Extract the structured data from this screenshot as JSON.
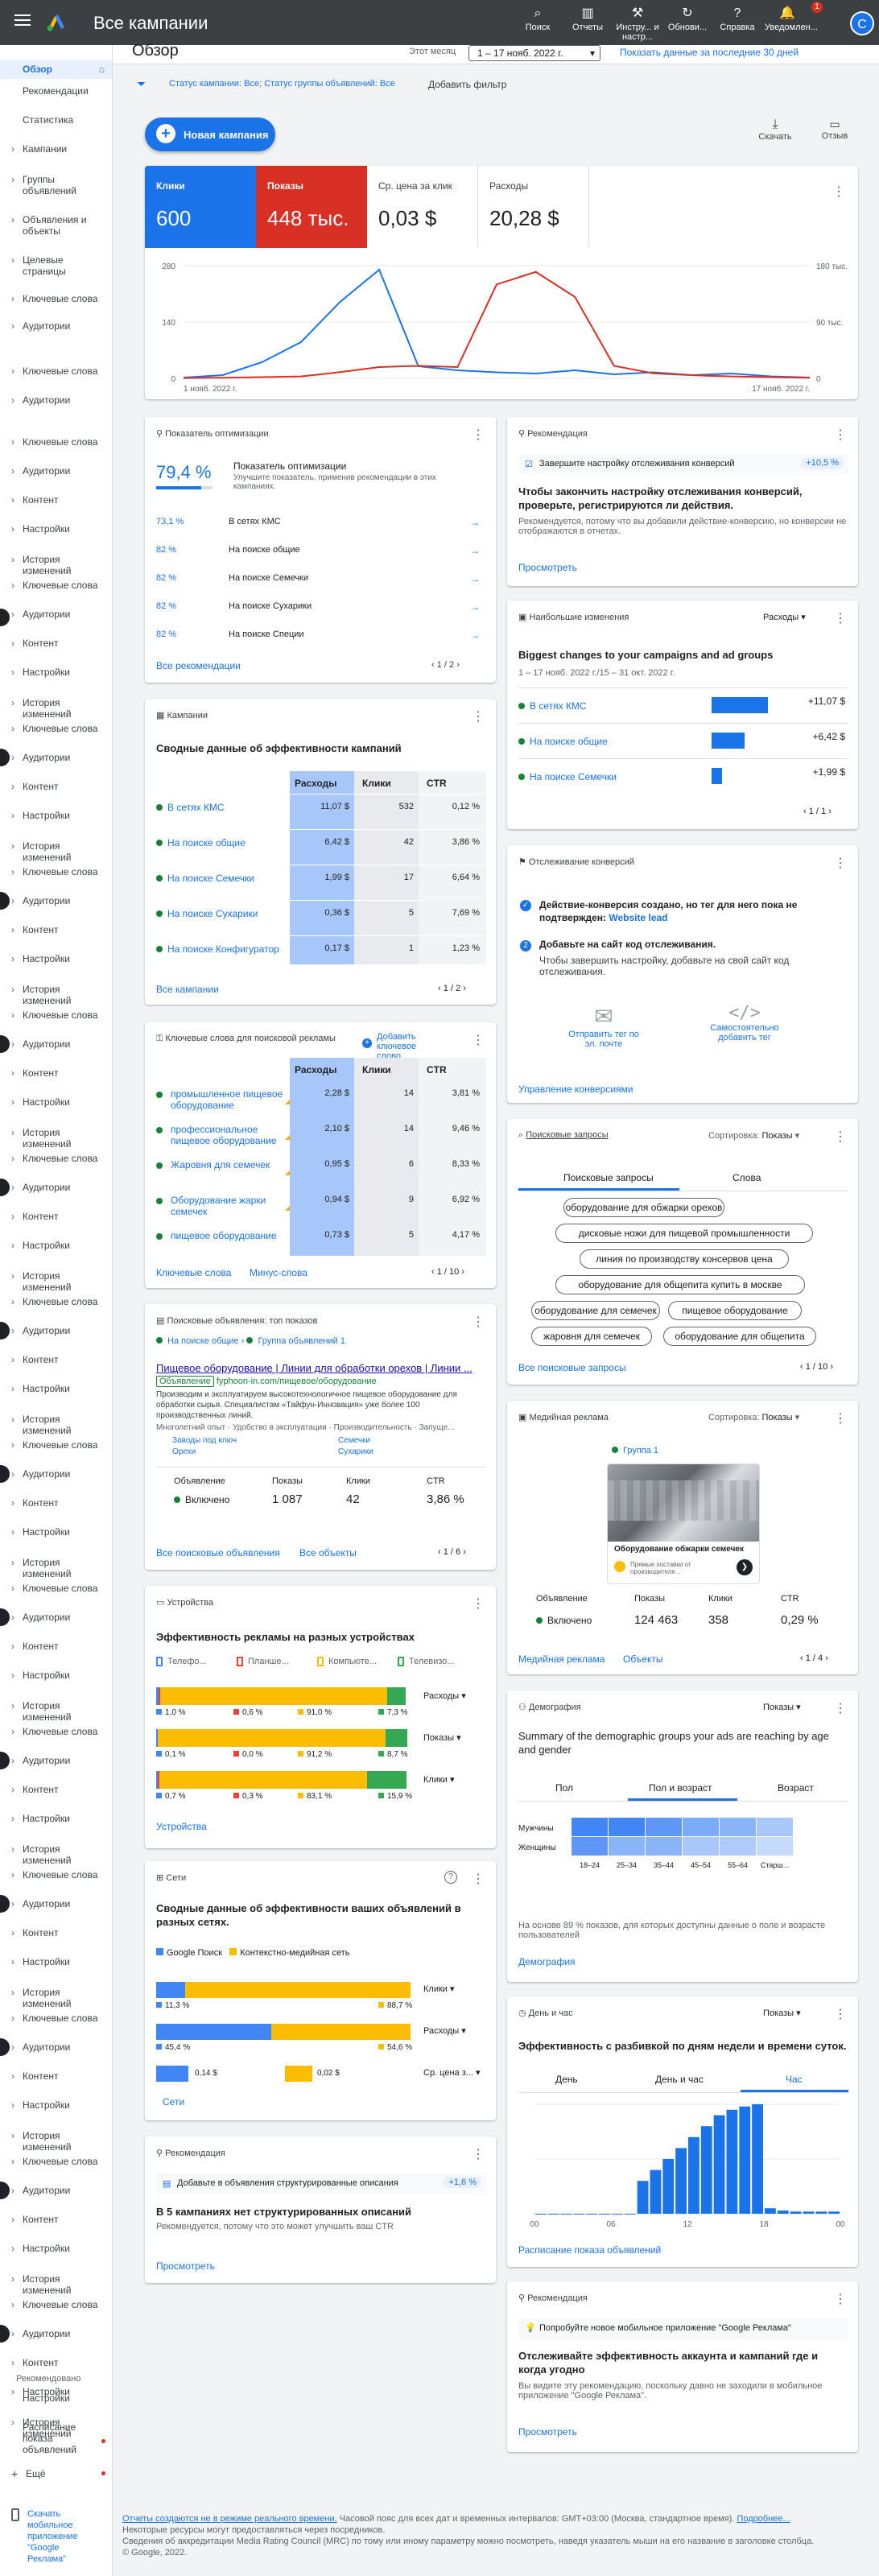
{
  "app": {
    "title": "Все кампании",
    "avatar_letter": "C",
    "notif_count": "1"
  },
  "toolbar": {
    "items": [
      "Поиск",
      "Отчеты",
      "Инстру... и настр...",
      "Обнови...",
      "Справка",
      "Уведомлен..."
    ]
  },
  "sidebar": {
    "items": [
      {
        "label": "Обзор",
        "y": 80,
        "sel": true,
        "arrow": false
      },
      {
        "label": "Рекомендации",
        "y": 112,
        "arrow": false
      },
      {
        "label": "Статистика",
        "y": 148,
        "arrow": false
      },
      {
        "label": "Кампании",
        "y": 184,
        "arrow": true
      },
      {
        "label": "Группы объявлений",
        "y": 222,
        "arrow": true
      },
      {
        "label": "Объявления и объекты",
        "y": 272,
        "arrow": true
      },
      {
        "label": "Целевые страницы",
        "y": 322,
        "arrow": true
      },
      {
        "label": "Ключевые слова",
        "y": 370,
        "arrow": true
      },
      {
        "label": "Аудитории",
        "y": 404,
        "arrow": true
      },
      {
        "label": "Ключевые слова",
        "y": 460,
        "arrow": true
      },
      {
        "label": "Аудитории",
        "y": 496,
        "arrow": true
      },
      {
        "label": "Ключевые слова",
        "y": 548,
        "arrow": true
      },
      {
        "label": "Аудитории",
        "y": 584,
        "arrow": true
      },
      {
        "label": "Контент",
        "y": 620,
        "arrow": true
      },
      {
        "label": "Настройки",
        "y": 656,
        "arrow": true
      },
      {
        "label": "История изменений",
        "y": 694,
        "arrow": true
      },
      {
        "label": "Ключевые слова",
        "y": 726,
        "arrow": true
      },
      {
        "label": "Аудитории",
        "y": 762,
        "arrow": true
      },
      {
        "label": "Контент",
        "y": 798,
        "arrow": true
      },
      {
        "label": "Настройки",
        "y": 834,
        "arrow": true
      },
      {
        "label": "История изменений",
        "y": 872,
        "arrow": true
      },
      {
        "label": "Ключевые слова",
        "y": 904,
        "arrow": true
      },
      {
        "label": "Аудитории",
        "y": 940,
        "arrow": true
      },
      {
        "label": "Контент",
        "y": 976,
        "arrow": true
      },
      {
        "label": "Настройки",
        "y": 1012,
        "arrow": true
      },
      {
        "label": "История изменений",
        "y": 1050,
        "arrow": true
      },
      {
        "label": "Ключевые слова",
        "y": 1082,
        "arrow": true
      },
      {
        "label": "Аудитории",
        "y": 1118,
        "arrow": true
      },
      {
        "label": "Контент",
        "y": 1154,
        "arrow": true
      },
      {
        "label": "Настройки",
        "y": 1190,
        "arrow": true
      },
      {
        "label": "История изменений",
        "y": 1228,
        "arrow": true
      },
      {
        "label": "Ключевые слова",
        "y": 1260,
        "arrow": true
      },
      {
        "label": "Аудитории",
        "y": 1296,
        "arrow": true
      },
      {
        "label": "Контент",
        "y": 1332,
        "arrow": true
      },
      {
        "label": "Настройки",
        "y": 1368,
        "arrow": true
      },
      {
        "label": "История изменений",
        "y": 1406,
        "arrow": true
      },
      {
        "label": "Ключевые слова",
        "y": 1438,
        "arrow": true
      },
      {
        "label": "Аудитории",
        "y": 1474,
        "arrow": true
      },
      {
        "label": "Контент",
        "y": 1510,
        "arrow": true
      },
      {
        "label": "Настройки",
        "y": 1546,
        "arrow": true
      },
      {
        "label": "История изменений",
        "y": 1584,
        "arrow": true
      },
      {
        "label": "Ключевые слова",
        "y": 1616,
        "arrow": true
      },
      {
        "label": "Аудитории",
        "y": 1652,
        "arrow": true
      },
      {
        "label": "Контент",
        "y": 1688,
        "arrow": true
      },
      {
        "label": "Настройки",
        "y": 1724,
        "arrow": true
      },
      {
        "label": "История изменений",
        "y": 1762,
        "arrow": true
      },
      {
        "label": "Ключевые слова",
        "y": 1794,
        "arrow": true
      },
      {
        "label": "Аудитории",
        "y": 1830,
        "arrow": true
      },
      {
        "label": "Контент",
        "y": 1866,
        "arrow": true
      },
      {
        "label": "Настройки",
        "y": 1902,
        "arrow": true
      },
      {
        "label": "История изменений",
        "y": 1940,
        "arrow": true
      },
      {
        "label": "Ключевые слова",
        "y": 1972,
        "arrow": true
      },
      {
        "label": "Аудитории",
        "y": 2008,
        "arrow": true
      },
      {
        "label": "Контент",
        "y": 2044,
        "arrow": true
      },
      {
        "label": "Настройки",
        "y": 2080,
        "arrow": true
      },
      {
        "label": "История изменений",
        "y": 2118,
        "arrow": true
      },
      {
        "label": "Ключевые слова",
        "y": 2150,
        "arrow": true
      },
      {
        "label": "Аудитории",
        "y": 2186,
        "arrow": true
      },
      {
        "label": "Контент",
        "y": 2222,
        "arrow": true
      },
      {
        "label": "Настройки",
        "y": 2258,
        "arrow": true
      },
      {
        "label": "История изменений",
        "y": 2296,
        "arrow": true
      },
      {
        "label": "Ключевые слова",
        "y": 2328,
        "arrow": true
      },
      {
        "label": "Аудитории",
        "y": 2364,
        "arrow": true
      },
      {
        "label": "Контент",
        "y": 2400,
        "arrow": true
      },
      {
        "label": "Настройки",
        "y": 2436,
        "arrow": true
      },
      {
        "label": "История изменений",
        "y": 2474,
        "arrow": true
      },
      {
        "label": "Ключевые слова",
        "y": 2506,
        "arrow": true
      },
      {
        "label": "Аудитории",
        "y": 2542,
        "arrow": true
      },
      {
        "label": "Контент",
        "y": 2578,
        "arrow": true
      },
      {
        "label": "Настройки",
        "y": 2614,
        "arrow": true
      },
      {
        "label": "История изменений",
        "y": 2652,
        "arrow": true
      },
      {
        "label": "Ключевые слова",
        "y": 2684,
        "arrow": true
      },
      {
        "label": "Аудитории",
        "y": 2720,
        "arrow": true
      },
      {
        "label": "Контент",
        "y": 2756,
        "arrow": true
      },
      {
        "label": "Настройки",
        "y": 2792,
        "arrow": true
      },
      {
        "label": "История изменений",
        "y": 2830,
        "arrow": true
      },
      {
        "label": "Ключевые слова",
        "y": 2862,
        "arrow": true
      },
      {
        "label": "Аудитории",
        "y": 2898,
        "arrow": true
      },
      {
        "label": "Контент",
        "y": 2934,
        "arrow": true
      },
      {
        "label": "Настройки",
        "y": 2970,
        "arrow": true
      },
      {
        "label": "История изменений",
        "y": 3008,
        "arrow": true
      }
    ],
    "bottom": {
      "recommended": "Рекомендовано",
      "settings": "Настройки",
      "schedule": "Расписание показа объявлений",
      "more": "Ещё",
      "mobile": "Скачать мобильное приложение \"Google Реклама\""
    }
  },
  "subbar": {
    "title": "Обзор",
    "period_label": "Этот месяц",
    "date_range": "1 – 17 нояб. 2022 г.",
    "show_last": "Показать данные за последние 30 дней"
  },
  "filter": {
    "text1": "Статус кампании: Все",
    "text2": "Статус группы объявлений: Все",
    "add": "Добавить фильтр"
  },
  "actions": {
    "new_campaign": "Новая кампания",
    "download": "Скачать",
    "feedback": "Отзыв"
  },
  "metrics": {
    "items": [
      {
        "label": "Клики",
        "value": "600"
      },
      {
        "label": "Показы",
        "value": "448 тыс."
      },
      {
        "label": "Ср. цена за клик",
        "value": "0,03 $"
      },
      {
        "label": "Расходы",
        "value": "20,28 $"
      }
    ]
  },
  "chart_data": {
    "type": "line",
    "x": [
      "1 нояб. 2022 г.",
      "",
      "",
      "",
      "",
      "",
      "",
      "",
      "",
      "",
      "",
      "",
      "",
      "",
      "",
      "",
      "17 нояб. 2022 г."
    ],
    "series": [
      {
        "name": "Клики",
        "values": [
          2,
          8,
          40,
          90,
          190,
          270,
          30,
          20,
          15,
          12,
          20,
          10,
          15,
          8,
          12,
          5,
          2
        ]
      },
      {
        "name": "Показы",
        "values": [
          0.5,
          1,
          2,
          3,
          10,
          18,
          20,
          18,
          150,
          170,
          130,
          20,
          8,
          5,
          3,
          2,
          1
        ]
      }
    ],
    "ylim_left": [
      0,
      280
    ],
    "yticks_left": [
      "0",
      "140",
      "280"
    ],
    "yticks_right": [
      "0",
      "90 тыс.",
      "180 тыс."
    ],
    "ylim_right": [
      0,
      180
    ]
  },
  "optscore": {
    "title": "Показатель оптимизации",
    "value": "79,4 %",
    "heading": "Показатель оптимизации",
    "desc": "Улучшите показатель, применив рекомендации в этих кампаниях.",
    "rows": [
      {
        "pct": "73,1 %",
        "name": "В сетях КМС"
      },
      {
        "pct": "82 %",
        "name": "На поиске общие"
      },
      {
        "pct": "82 %",
        "name": "На поиске Семечки"
      },
      {
        "pct": "82 %",
        "name": "На поиске Сухарики"
      },
      {
        "pct": "82 %",
        "name": "На поиске Специи"
      }
    ],
    "all": "Все рекомендации",
    "pages": "1 / 2"
  },
  "rec1": {
    "title": "Рекомендация",
    "text": "Завершите настройку отслеживания конверсий",
    "delta": "+10,5 %",
    "heading": "Чтобы закончить настройку отслеживания конверсий, проверьте, регистрируются ли действия.",
    "desc": "Рекомендуется, потому что вы добавили действие-конверсию, но конверсии не отображаются в отчетах.",
    "link": "Просмотреть"
  },
  "changes": {
    "title": "Наибольшие изменения",
    "metric": "Расходы",
    "heading": "Biggest changes to your campaigns and ad groups",
    "period": "1 – 17 нояб. 2022 г./15 – 31 окт. 2022 г.",
    "rows": [
      {
        "name": "В сетях КМС",
        "val": "+11,07 $",
        "bar": 1.0
      },
      {
        "name": "На поиске общие",
        "val": "+6,42 $",
        "bar": 0.58
      },
      {
        "name": "На поиске Семечки",
        "val": "+1,99 $",
        "bar": 0.18
      }
    ],
    "pages": "1 / 1"
  },
  "campaigns": {
    "title": "Кампании",
    "heading": "Сводные данные об эффективности кампаний",
    "cols": [
      "Расходы",
      "Клики",
      "CTR"
    ],
    "rows": [
      {
        "name": "В сетях КМС",
        "cost": "11,07 $",
        "clicks": "532",
        "ctr": "0,12 %"
      },
      {
        "name": "На поиске общие",
        "cost": "6,42 $",
        "clicks": "42",
        "ctr": "3,86 %"
      },
      {
        "name": "На поиске Семечки",
        "cost": "1,99 $",
        "clicks": "17",
        "ctr": "6,64 %"
      },
      {
        "name": "На поиске Сухарики",
        "cost": "0,36 $",
        "clicks": "5",
        "ctr": "7,69 %"
      },
      {
        "name": "На поиске Конфигуратор",
        "cost": "0,17 $",
        "clicks": "1",
        "ctr": "1,23 %"
      }
    ],
    "all": "Все кампании",
    "pages": "1 / 2"
  },
  "conversions": {
    "title": "Отслеживание конверсий",
    "step1": "Действие-конверсия создано, но тег для него пока не подтвержден:",
    "step1_link": "Website lead",
    "step2": "Добавьте на сайт код отслеживания.",
    "step2_desc": "Чтобы завершить настройку, добавьте на свой сайт код отслеживания.",
    "opt1": "Отправить тег по эл. почте",
    "opt2": "Самостоятельно добавить тег",
    "link": "Управление конверсиями"
  },
  "keywords": {
    "title": "Ключевые слова для поисковой рекламы",
    "add": "Добавить ключевое слово",
    "cols": [
      "Расходы",
      "Клики",
      "CTR"
    ],
    "rows": [
      {
        "name": "промышленное пищевое оборудование",
        "cost": "2,28 $",
        "clicks": "14",
        "ctr": "3,81 %"
      },
      {
        "name": "профессиональное пищевое оборудование",
        "cost": "2,10 $",
        "clicks": "14",
        "ctr": "9,46 %"
      },
      {
        "name": "Жаровня для семечек",
        "cost": "0,95 $",
        "clicks": "6",
        "ctr": "8,33 %"
      },
      {
        "name": "Оборудование жарки семечек",
        "cost": "0,94 $",
        "clicks": "9",
        "ctr": "6,92 %"
      },
      {
        "name": "пищевое оборудование",
        "cost": "0,73 $",
        "clicks": "5",
        "ctr": "4,17 %"
      }
    ],
    "link1": "Ключевые слова",
    "link2": "Минус-слова",
    "pages": "1 / 10"
  },
  "searches": {
    "title": "Поисковые запросы",
    "sort_label": "Сортировка:",
    "sort": "Показы",
    "tab1": "Поисковые запросы",
    "tab2": "Слова",
    "pills": [
      "оборудование для обжарки орехов",
      "дисковые ножи для пищевой промышленности",
      "линия по производству консервов цена",
      "оборудование для общепита купить в москве",
      "оборудование для семечек",
      "пищевое оборудование",
      "жаровня для семечек",
      "оборудование для общепита"
    ],
    "link": "Все поисковые запросы",
    "pages": "1 / 10"
  },
  "searchads": {
    "title": "Поисковые объявления: топ показов",
    "campaign": "На поиске общие",
    "group": "Группа объявлений 1",
    "headline": "Пищевое оборудование | Линии для обработки орехов | Линии ...",
    "ad_label": "Объявление",
    "url": "fyphoon-in.com/пищевое/оборудование",
    "desc": "Производим и эксплуатируем высокотехнологичное пищевое оборудование для обработки сырья. Специалистам «Тайфун-Инновация» уже более 100 производственных линий.",
    "sitelinks_row": [
      "Многолетний опыт",
      "Удобство в эксплуатации",
      "Производительность",
      "Запуще..."
    ],
    "sitelinks2": [
      "Заводы под ключ",
      "Семечки"
    ],
    "sitelinks3": [
      "Орехи",
      "Сухарики"
    ],
    "cols": [
      "Объявление",
      "Показы",
      "Клики",
      "CTR"
    ],
    "status": "Включено",
    "impr": "1 087",
    "clicks": "42",
    "ctr": "3,86 %",
    "link1": "Все поисковые объявления",
    "link2": "Все объекты",
    "pages": "1 / 6"
  },
  "display": {
    "title": "Медийная реклама",
    "sort_label": "Сортировка:",
    "sort": "Показы",
    "group": "Группа 1",
    "ad_caption": "Оборудование обжарки семечек",
    "ad_small": "Прямые поставки от производителя...",
    "cols": [
      "Объявление",
      "Показы",
      "Клики",
      "CTR"
    ],
    "status": "Включено",
    "impr": "124 463",
    "clicks": "358",
    "ctr": "0,29 %",
    "link1": "Медийная реклама",
    "link2": "Объекты",
    "pages": "1 / 4"
  },
  "devices": {
    "title": "Устройства",
    "heading": "Эффективность рекламы на разных устройствах",
    "legend": [
      "Телефо...",
      "Планше...",
      "Компьюте...",
      "Телевизо..."
    ],
    "colors": [
      "#4285f4",
      "#ea4335",
      "#fbbc04",
      "#34a853"
    ],
    "rows": [
      {
        "metric": "Расходы",
        "vals": [
          1.0,
          0.6,
          91.0,
          7.3
        ],
        "labels": [
          "1,0 %",
          "0,6 %",
          "91,0 %",
          "7,3 %"
        ]
      },
      {
        "metric": "Показы",
        "vals": [
          0.1,
          0.0,
          91.2,
          8.7
        ],
        "labels": [
          "0,1 %",
          "0,0 %",
          "91,2 %",
          "8,7 %"
        ]
      },
      {
        "metric": "Клики",
        "vals": [
          0.7,
          0.3,
          83.1,
          15.9
        ],
        "labels": [
          "0,7 %",
          "0,3 %",
          "83,1 %",
          "15,9 %"
        ]
      }
    ],
    "link": "Устройства"
  },
  "demographics": {
    "title": "Демография",
    "metric": "Показы",
    "heading": "Summary of the demographic groups your ads are reaching by age and gender",
    "tabs": [
      "Пол",
      "Пол и возраст",
      "Возраст"
    ],
    "rows": [
      "Мужчины",
      "Женщины"
    ],
    "cols": [
      "18–24",
      "25–34",
      "35–44",
      "45–54",
      "55–64",
      "Старш..."
    ],
    "desc": "На основе 89 % показов, для которых доступны данные о поле и возрасте пользователей",
    "link": "Демография"
  },
  "networks": {
    "title": "Сети",
    "heading": "Сводные данные об эффективности ваших объявлений в разных сетях.",
    "legend": [
      "Google Поиск",
      "Контекстно-медийная сеть"
    ],
    "rows": [
      {
        "metric": "Клики",
        "a": 11.3,
        "b": 88.7,
        "la": "11,3 %",
        "lb": "88,7 %"
      },
      {
        "metric": "Расходы",
        "a": 45.4,
        "b": 54.6,
        "la": "45,4 %",
        "lb": "54,6 %"
      },
      {
        "metric": "Ср. цена з...",
        "a": 0.14,
        "b": 0.02,
        "la": "0,14 $",
        "lb": "0,02 $"
      }
    ],
    "link": "Сети"
  },
  "dayhour": {
    "title": "День и час",
    "metric": "Показы",
    "heading": "Эффективность с разбивкой по дням недели и времени суток.",
    "tabs": [
      "День",
      "День и час",
      "Час"
    ],
    "xticks": [
      "00",
      "06",
      "12",
      "18",
      "00"
    ],
    "values": [
      0,
      0,
      0,
      0,
      0,
      0,
      0,
      0,
      0.3,
      0.4,
      0.5,
      0.6,
      0.7,
      0.8,
      0.9,
      0.95,
      0.98,
      1.0,
      0.05,
      0.03,
      0.02,
      0.02,
      0.02,
      0.02
    ],
    "link": "Расписание показа объявлений"
  },
  "rec2": {
    "title": "Рекомендация",
    "text": "Добавьте в объявления структурированные описания",
    "delta": "+1,6 %",
    "heading": "В 5 кампаниях нет структурированных описаний",
    "desc": "Рекомендуется, потому что это может улучшить ваш CTR",
    "link": "Просмотреть"
  },
  "rec3": {
    "title": "Рекомендация",
    "text": "Попробуйте новое мобильное приложение \"Google Реклама\"",
    "heading": "Отслеживайте эффективность аккаунта и кампаний где и когда угодно",
    "desc": "Вы видите эту рекомендацию, поскольку давно не заходили в мобильное приложение \"Google Реклама\".",
    "link": "Просмотреть"
  },
  "footer": {
    "l1a": "Отчеты создаются не в режиме реального времени.",
    "l1b": "Часовой пояс для всех дат и временных интервалов: GMT+03:00 (Москва, стандартное время).",
    "l1c": "Подробнее...",
    "l2": "Некоторые ресурсы могут предоставляться через посредников.",
    "l3": "Сведения об аккредитации Media Rating Council (MRC) по тому или иному параметру можно посмотреть, наведя указатель мыши на его название в заголовке столбца.",
    "l4": "© Google, 2022."
  }
}
